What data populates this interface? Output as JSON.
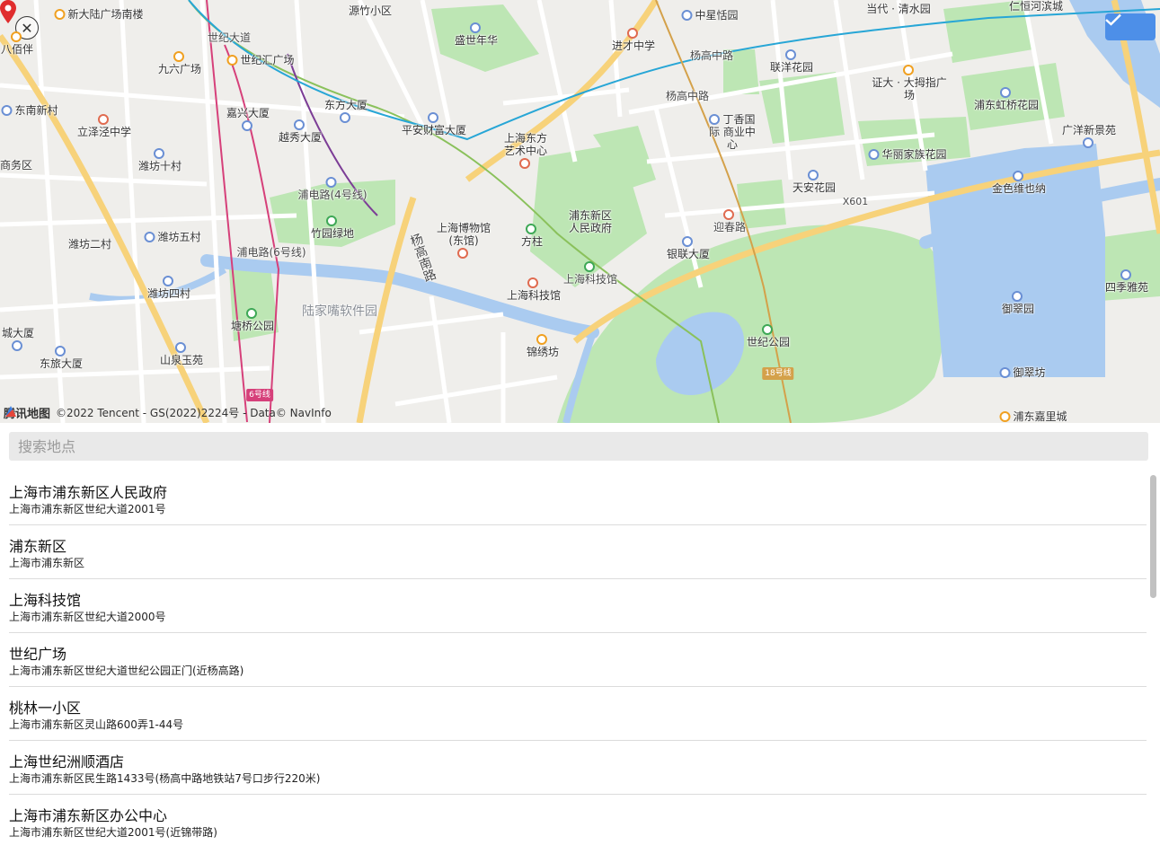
{
  "map": {
    "attribution_logo": "腾讯地图",
    "attribution_text": "©2022 Tencent - GS(2022)2224号 - Data© NavInfo",
    "labels": {
      "xindalu": "新大陆广场南楼",
      "yuanzhu": "源竹小区",
      "shengshinianhua": "盛世年华",
      "jincaizhongxue": "进才中学",
      "zhongxingtianyuan": "中星恬园",
      "dangdai": "当代 · 清水园",
      "renhenghebin": "仁恒河滨城",
      "babaiban": "八佰伴",
      "shijidadao": "世纪大道",
      "jiuliu": "九六广场",
      "shijihui": "世纪汇广场",
      "yanggaozhonglu1": "杨高中路",
      "yanggaozhonglu2": "杨高中路",
      "lianyang": "联洋花园",
      "zhengda": "证大 · 大拇指广场",
      "dongnanxincun": "东南新村",
      "lijingzhongxue": "立泽泾中学",
      "jiaxing": "嘉兴大厦",
      "dongfang": "东方大厦",
      "pingan": "平安财富大厦",
      "dingxiang": "丁香国际 商业中心",
      "pudonghongqiao": "浦东虹桥花园",
      "guangyang": "广洋新景苑",
      "shangwuqu": "商务区",
      "weifangshicun": "潍坊十村",
      "yuexiu": "越秀大厦",
      "dongfangyishu": "上海东方 艺术中心",
      "huali": "华丽家族花园",
      "tianan": "天安花园",
      "jinseweiyena": "金色维也纳",
      "pudianlu4": "浦电路(4号线)",
      "x601": "X601",
      "bowuguan": "上海博物馆 (东馆)",
      "zhuyuan": "竹园绿地",
      "fangzhu": "方柱",
      "zhengfu": "浦东新区 人民政府",
      "yingchunlu": "迎春路",
      "weifangercun": "潍坊二村",
      "weifangwucun": "潍坊五村",
      "pudianlu6": "浦电路(6号线)",
      "yanggaonanlu": "杨高南路",
      "yinlian": "银联大厦",
      "kejiguan1": "上海科技馆",
      "kejiguan2": "上海科技馆",
      "siji": "四季雅苑",
      "weifangsicun": "潍坊四村",
      "yujing": "御翠园",
      "lujiazui": "陆家嘴软件园",
      "tangqiao": "塘桥公园",
      "shijigongyuan": "世纪公园",
      "chengdasha": "城大厦",
      "jinxiufang": "锦绣坊",
      "dongluyuan": "东旅大厦",
      "shanquan": "山泉玉苑",
      "yucuifang": "御翠坊",
      "line6": "6号线",
      "line18": "18号线",
      "jiali": "浦东嘉里城"
    }
  },
  "search": {
    "placeholder": "搜索地点",
    "value": ""
  },
  "results": [
    {
      "title": "上海市浦东新区人民政府",
      "address": "上海市浦东新区世纪大道2001号"
    },
    {
      "title": "浦东新区",
      "address": "上海市浦东新区"
    },
    {
      "title": "上海科技馆",
      "address": "上海市浦东新区世纪大道2000号"
    },
    {
      "title": "世纪广场",
      "address": "上海市浦东新区世纪大道世纪公园正门(近杨高路)"
    },
    {
      "title": "桃林一小区",
      "address": "上海市浦东新区灵山路600弄1-44号"
    },
    {
      "title": "上海世纪洲顺酒店",
      "address": "上海市浦东新区民生路1433号(杨高中路地铁站7号口步行220米)"
    },
    {
      "title": "上海市浦东新区办公中心",
      "address": "上海市浦东新区世纪大道2001号(近锦带路)"
    }
  ],
  "colors": {
    "confirm": "#4d8fe8",
    "water": "#aacbf0",
    "park": "#bde6b4",
    "metro_line2": "#8ac15b",
    "metro_line6": "#d6407a",
    "metro_line4": "#7c3d96",
    "metro_line9": "#27a6d6",
    "metro_line18": "#d4a14a",
    "road_main": "#f7d27a"
  },
  "icons": {
    "close": "close-circle-icon",
    "confirm": "check-icon",
    "pin": "map-pin-icon"
  }
}
